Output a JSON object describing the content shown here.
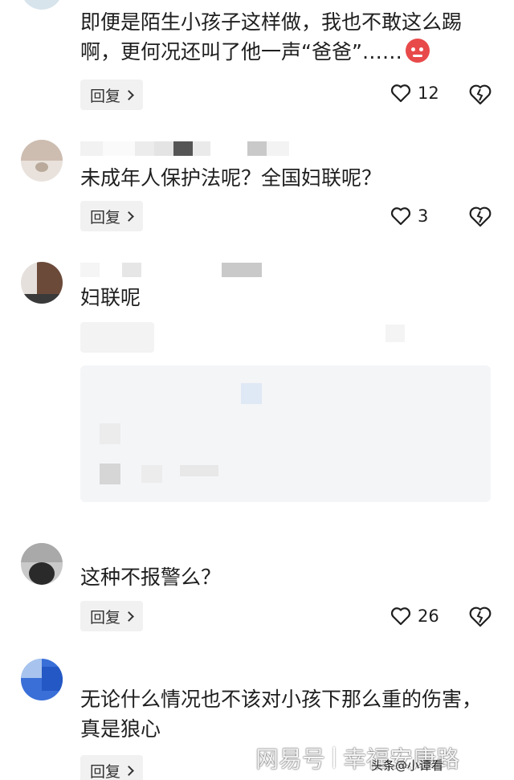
{
  "comments": [
    {
      "text": "即便是陌生小孩子这样做，我也不敢这么踢啊，更何况还叫了他一声“爸爸”……",
      "emoji": "angry-face-emoji",
      "reply_label": "回复",
      "likes": "12"
    },
    {
      "text": "未成年人保护法呢？全国妇联呢？",
      "reply_label": "回复",
      "likes": "3"
    },
    {
      "text": "妇联呢"
    },
    {
      "text": "这种不报警么？",
      "reply_label": "回复",
      "likes": "26"
    },
    {
      "text": "无论什么情况也不该对小孩下那么重的伤害，真是狼心",
      "reply_label": "回复"
    }
  ],
  "watermark": {
    "brand": "网易号",
    "author": "幸福安康路"
  },
  "credit": "头条@小谭看"
}
